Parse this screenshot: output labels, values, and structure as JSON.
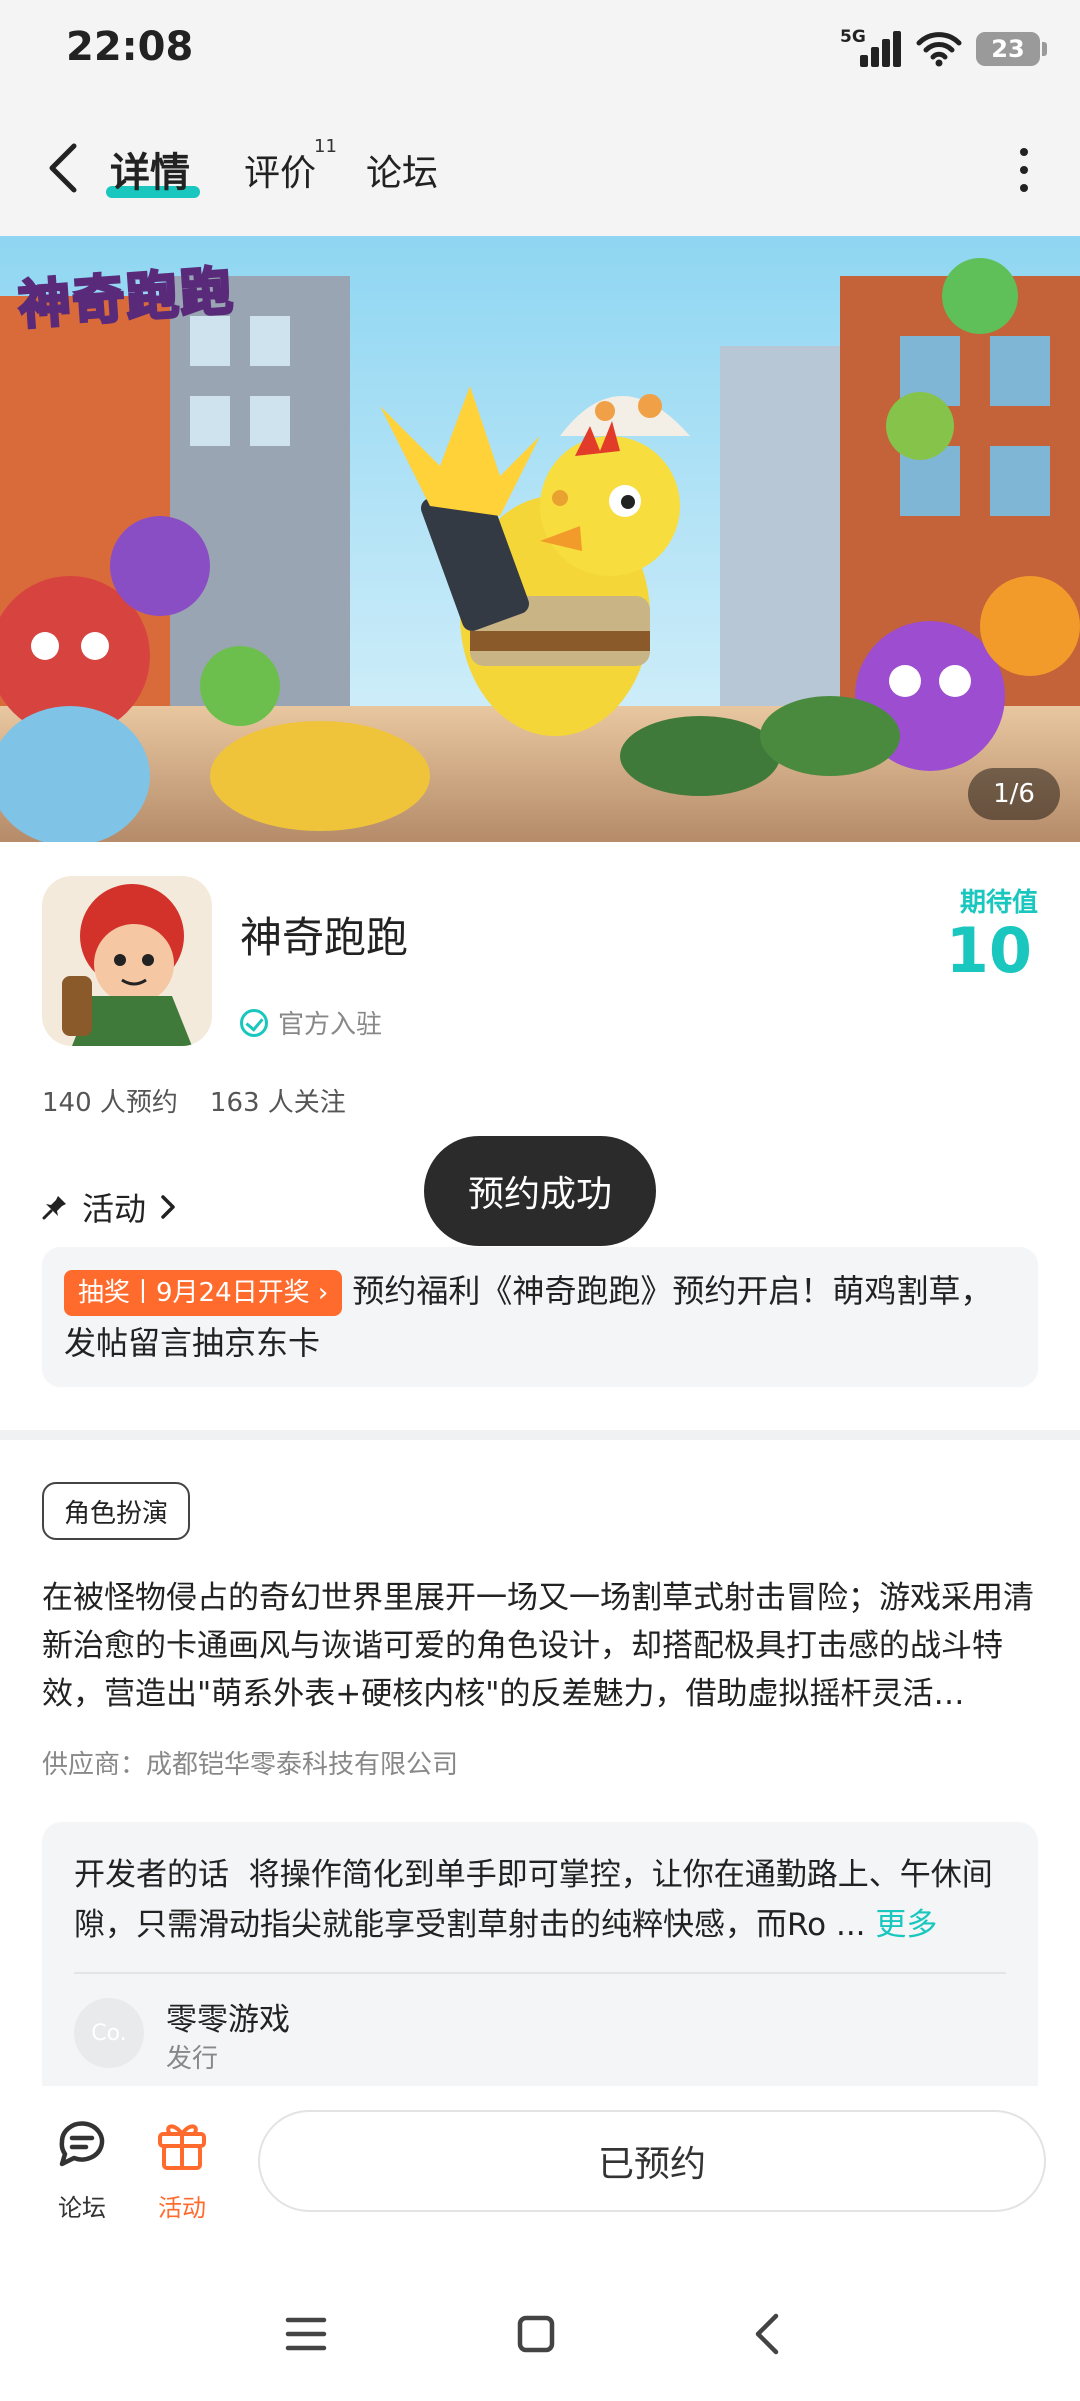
{
  "status_bar": {
    "time": "22:08",
    "network": "5G",
    "battery": "23"
  },
  "nav": {
    "tabs": [
      {
        "label": "详情",
        "active": true
      },
      {
        "label": "评价",
        "badge": "11"
      },
      {
        "label": "论坛"
      }
    ]
  },
  "banner": {
    "logo_text": "神奇跑跑",
    "page_indicator": "1/6"
  },
  "app": {
    "name": "神奇跑跑",
    "official_label": "官方入驻",
    "expect_label": "期待值",
    "expect_value": "10",
    "reservations": "140 人预约",
    "followers": "163 人关注"
  },
  "toast": "预约成功",
  "activity": {
    "heading": "活动",
    "tag": "抽奖丨9月24日开奖",
    "text": "预约福利《神奇跑跑》预约开启！萌鸡割草，发帖留言抽京东卡"
  },
  "description": {
    "genre": "角色扮演",
    "text": "在被怪物侵占的奇幻世界里展开一场又一场割草式射击冒险；游戏采用清新治愈的卡通画风与诙谐可爱的角色设计，却搭配极具打击感的战斗特效，营造出\"萌系外表+硬核内核\"的反差魅力，借助虚拟摇杆灵活…",
    "supplier": "供应商：成都铠华零泰科技有限公司"
  },
  "developer": {
    "label": "开发者的话",
    "text": "将操作简化到单手即可掌控，让你在通勤路上、午休间隙，只需滑动指尖就能享受割草射击的纯粹快感，而Ro ...",
    "more": "更多",
    "publisher_avatar": "Co.",
    "publisher_name": "零零游戏",
    "publisher_role": "发行"
  },
  "bottom_bar": {
    "forum_label": "论坛",
    "activity_label": "活动",
    "reserve_button": "已预约"
  },
  "colors": {
    "accent": "#19c7bf",
    "activity_orange": "#ff6b2d",
    "toast_bg": "#2b2b2b"
  }
}
